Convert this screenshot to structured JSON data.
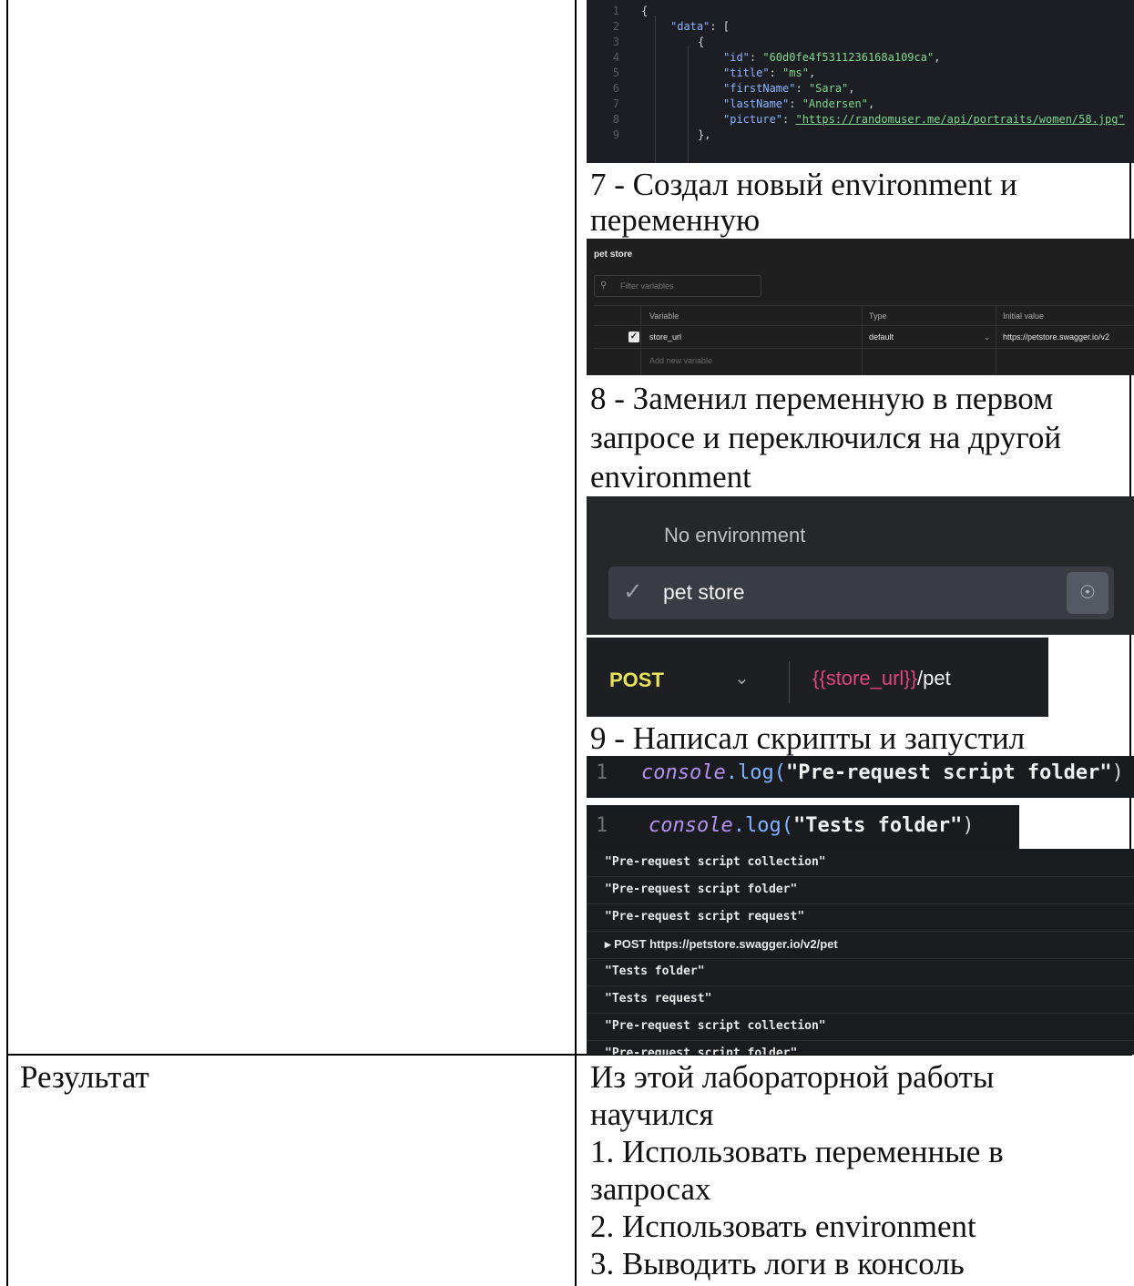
{
  "json_editor": {
    "lines": [
      {
        "n": "1",
        "text": "{"
      },
      {
        "n": "2",
        "key": "\"data\"",
        "rest": ": ["
      },
      {
        "n": "3",
        "text": "{"
      },
      {
        "n": "4",
        "key": "\"id\"",
        "val": "\"60d0fe4f5311236168a109ca\""
      },
      {
        "n": "5",
        "key": "\"title\"",
        "val": "\"ms\""
      },
      {
        "n": "6",
        "key": "\"firstName\"",
        "val": "\"Sara\""
      },
      {
        "n": "7",
        "key": "\"lastName\"",
        "val": "\"Andersen\""
      },
      {
        "n": "8",
        "key": "\"picture\"",
        "val": "\"https://randomuser.me/api/portraits/women/58.jpg\""
      },
      {
        "n": "9",
        "text": "},"
      }
    ]
  },
  "step7": {
    "line1": "7 - Создал новый environment и",
    "line2": "переменную"
  },
  "env_table": {
    "title": "pet store",
    "filter_placeholder": "Filter variables",
    "headers": {
      "variable": "Variable",
      "type": "Type",
      "initial": "Initial value"
    },
    "row": {
      "variable": "store_url",
      "type": "default",
      "initial": "https://petstore.swagger.io/v2"
    },
    "add_placeholder": "Add new variable"
  },
  "step8": {
    "line1": "8 - Заменил переменную в первом",
    "line2": "запросе и переключился на другой",
    "line3": "environment"
  },
  "env_dropdown": {
    "no_env": "No environment",
    "selected": "pet store"
  },
  "request_bar": {
    "method": "POST",
    "url_var": "{{store_url}}",
    "url_path": "/pet"
  },
  "step9": {
    "text": "9 - Написал скрипты и запустил"
  },
  "pre_request_script": {
    "ln": "1",
    "obj": "console",
    "fn": ".log(",
    "str": "\"Pre-request script folder\"",
    "close": ")"
  },
  "tests_script": {
    "ln": "1",
    "obj": "console",
    "fn": ".log(",
    "str": "\"Tests folder\"",
    "close": ")"
  },
  "console_log": [
    "\"Pre-request script collection\"",
    "\"Pre-request script folder\"",
    "\"Pre-request script request\"",
    "▸ POST https://petstore.swagger.io/v2/pet",
    "\"Tests folder\"",
    "\"Tests request\"",
    "\"Pre-request script collection\"",
    "\"Pre-request script folder\""
  ],
  "result": {
    "label": "Результат",
    "lines": [
      "Из этой лабораторной работы",
      "научился",
      "1. Использовать переменные в",
      "запросах",
      "2. Использовать environment",
      "3. Выводить логи в консоль"
    ]
  }
}
